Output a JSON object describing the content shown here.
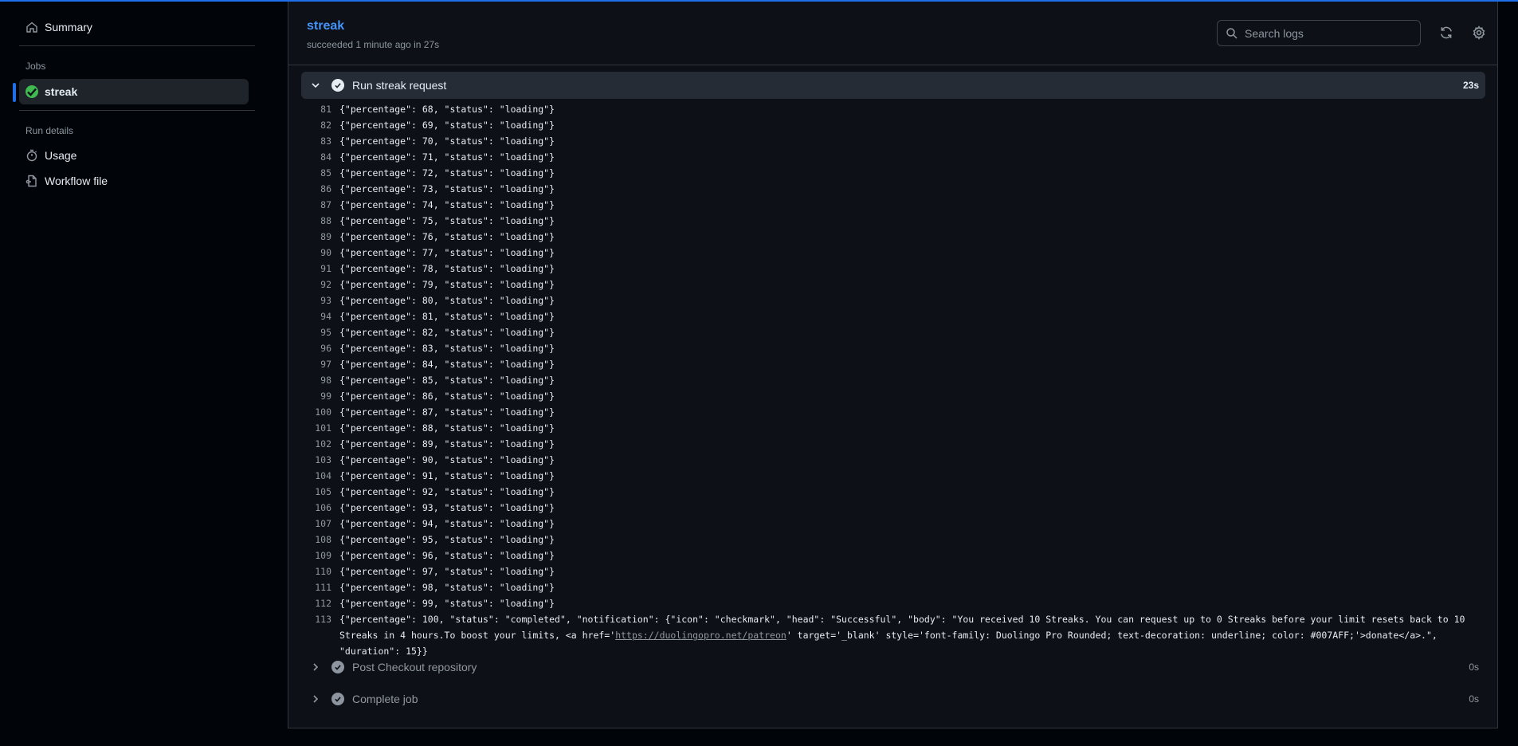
{
  "sidebar": {
    "summary_label": "Summary",
    "jobs_heading": "Jobs",
    "active_job": "streak",
    "run_details_heading": "Run details",
    "usage_label": "Usage",
    "workflow_file_label": "Workflow file"
  },
  "header": {
    "title": "streak",
    "subtitle": "succeeded 1 minute ago in 27s",
    "search_placeholder": "Search logs"
  },
  "steps": {
    "run": {
      "label": "Run streak request",
      "duration": "23s",
      "state": "expanded"
    },
    "post_checkout": {
      "label": "Post Checkout repository",
      "duration": "0s",
      "state": "collapsed"
    },
    "complete": {
      "label": "Complete job",
      "duration": "0s",
      "state": "collapsed"
    }
  },
  "log_lines": [
    {
      "n": "81",
      "text": "{\"percentage\": 68, \"status\": \"loading\"}"
    },
    {
      "n": "82",
      "text": "{\"percentage\": 69, \"status\": \"loading\"}"
    },
    {
      "n": "83",
      "text": "{\"percentage\": 70, \"status\": \"loading\"}"
    },
    {
      "n": "84",
      "text": "{\"percentage\": 71, \"status\": \"loading\"}"
    },
    {
      "n": "85",
      "text": "{\"percentage\": 72, \"status\": \"loading\"}"
    },
    {
      "n": "86",
      "text": "{\"percentage\": 73, \"status\": \"loading\"}"
    },
    {
      "n": "87",
      "text": "{\"percentage\": 74, \"status\": \"loading\"}"
    },
    {
      "n": "88",
      "text": "{\"percentage\": 75, \"status\": \"loading\"}"
    },
    {
      "n": "89",
      "text": "{\"percentage\": 76, \"status\": \"loading\"}"
    },
    {
      "n": "90",
      "text": "{\"percentage\": 77, \"status\": \"loading\"}"
    },
    {
      "n": "91",
      "text": "{\"percentage\": 78, \"status\": \"loading\"}"
    },
    {
      "n": "92",
      "text": "{\"percentage\": 79, \"status\": \"loading\"}"
    },
    {
      "n": "93",
      "text": "{\"percentage\": 80, \"status\": \"loading\"}"
    },
    {
      "n": "94",
      "text": "{\"percentage\": 81, \"status\": \"loading\"}"
    },
    {
      "n": "95",
      "text": "{\"percentage\": 82, \"status\": \"loading\"}"
    },
    {
      "n": "96",
      "text": "{\"percentage\": 83, \"status\": \"loading\"}"
    },
    {
      "n": "97",
      "text": "{\"percentage\": 84, \"status\": \"loading\"}"
    },
    {
      "n": "98",
      "text": "{\"percentage\": 85, \"status\": \"loading\"}"
    },
    {
      "n": "99",
      "text": "{\"percentage\": 86, \"status\": \"loading\"}"
    },
    {
      "n": "100",
      "text": "{\"percentage\": 87, \"status\": \"loading\"}"
    },
    {
      "n": "101",
      "text": "{\"percentage\": 88, \"status\": \"loading\"}"
    },
    {
      "n": "102",
      "text": "{\"percentage\": 89, \"status\": \"loading\"}"
    },
    {
      "n": "103",
      "text": "{\"percentage\": 90, \"status\": \"loading\"}"
    },
    {
      "n": "104",
      "text": "{\"percentage\": 91, \"status\": \"loading\"}"
    },
    {
      "n": "105",
      "text": "{\"percentage\": 92, \"status\": \"loading\"}"
    },
    {
      "n": "106",
      "text": "{\"percentage\": 93, \"status\": \"loading\"}"
    },
    {
      "n": "107",
      "text": "{\"percentage\": 94, \"status\": \"loading\"}"
    },
    {
      "n": "108",
      "text": "{\"percentage\": 95, \"status\": \"loading\"}"
    },
    {
      "n": "109",
      "text": "{\"percentage\": 96, \"status\": \"loading\"}"
    },
    {
      "n": "110",
      "text": "{\"percentage\": 97, \"status\": \"loading\"}"
    },
    {
      "n": "111",
      "text": "{\"percentage\": 98, \"status\": \"loading\"}"
    },
    {
      "n": "112",
      "text": "{\"percentage\": 99, \"status\": \"loading\"}"
    }
  ],
  "final_line": {
    "n": "113",
    "before_link": "{\"percentage\": 100, \"status\": \"completed\", \"notification\": {\"icon\": \"checkmark\", \"head\": \"Successful\", \"body\": \"You received 10 Streaks. You can request up to 0 Streaks before your limit resets back to 10 Streaks in 4 hours.To boost your limits, <a href='",
    "link_text": "https://duolingopro.net/patreon",
    "after_link": "' target='_blank' style='font-family: Duolingo Pro Rounded; text-decoration: underline; color: #007AFF;'>donate</a>.\", \"duration\": 15}}"
  },
  "colors": {
    "accent": "#1f6feb",
    "link": "#4493f8",
    "success": "#3fb950"
  }
}
